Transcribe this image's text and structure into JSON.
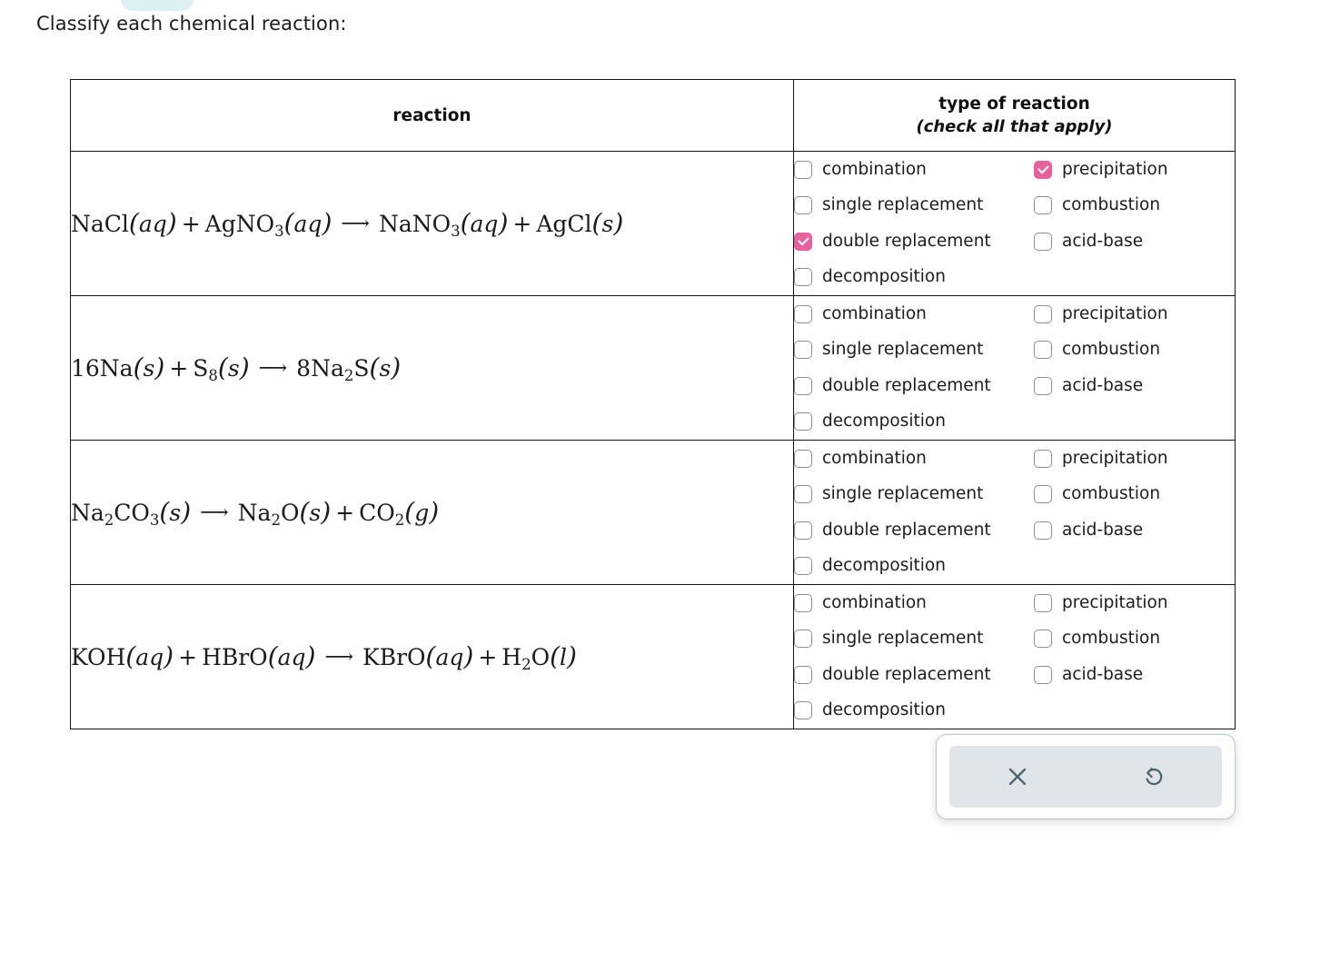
{
  "prompt": "Classify each chemical reaction:",
  "table": {
    "headers": {
      "reaction": "reaction",
      "type_title": "type of reaction",
      "type_subtitle": "(check all that apply)"
    },
    "option_labels": {
      "combination": "combination",
      "single_replacement": "single replacement",
      "double_replacement": "double replacement",
      "decomposition": "decomposition",
      "precipitation": "precipitation",
      "combustion": "combustion",
      "acid_base": "acid-base"
    },
    "rows": [
      {
        "equation_text": "NaCl(aq) + AgNO3(aq) → NaNO3(aq) + AgCl(s)",
        "options": {
          "combination": false,
          "single_replacement": false,
          "double_replacement": true,
          "decomposition": false,
          "precipitation": true,
          "combustion": false,
          "acid_base": false
        }
      },
      {
        "equation_text": "16Na(s) + S8(s) → 8Na2S(s)",
        "options": {
          "combination": false,
          "single_replacement": false,
          "double_replacement": false,
          "decomposition": false,
          "precipitation": false,
          "combustion": false,
          "acid_base": false
        }
      },
      {
        "equation_text": "Na2CO3(s) → Na2O(s) + CO2(g)",
        "options": {
          "combination": false,
          "single_replacement": false,
          "double_replacement": false,
          "decomposition": false,
          "precipitation": false,
          "combustion": false,
          "acid_base": false
        }
      },
      {
        "equation_text": "KOH(aq) + HBrO(aq) → KBrO(aq) + H2O(l)",
        "options": {
          "combination": false,
          "single_replacement": false,
          "double_replacement": false,
          "decomposition": false,
          "precipitation": false,
          "combustion": false,
          "acid_base": false
        }
      }
    ]
  },
  "action_panel": {
    "clear_icon": "close-x-icon",
    "reset_icon": "undo-refresh-icon"
  },
  "colors": {
    "checked_checkbox": "#e8619f",
    "checkbox_border": "#8a8f94",
    "panel_icon": "#4c6470",
    "panel_inner_bg": "#dfe5e8",
    "top_pill": "#ddf1f4"
  }
}
